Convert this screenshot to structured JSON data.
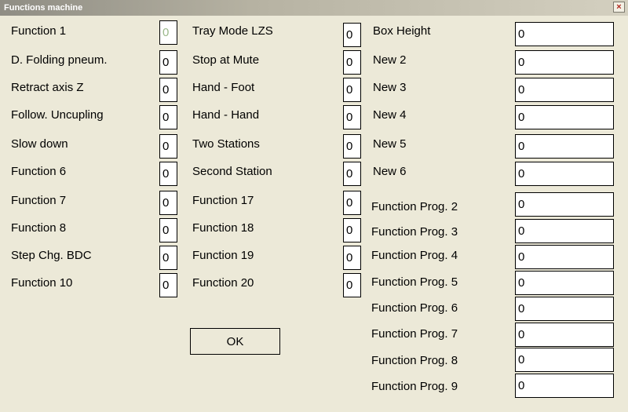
{
  "window": {
    "title": "Functions machine",
    "close_glyph": "×"
  },
  "col1": [
    {
      "label": "Function 1",
      "value": "0"
    },
    {
      "label": "D. Folding pneum.",
      "value": "0"
    },
    {
      "label": "Retract axis Z",
      "value": "0"
    },
    {
      "label": "Follow. Uncupling",
      "value": "0"
    },
    {
      "label": "Slow down",
      "value": "0"
    },
    {
      "label": "Function 6",
      "value": "0"
    },
    {
      "label": "Function 7",
      "value": "0"
    },
    {
      "label": "Function 8",
      "value": "0"
    },
    {
      "label": "Step Chg. BDC",
      "value": "0"
    },
    {
      "label": "Function 10",
      "value": "0"
    }
  ],
  "col2": [
    {
      "label": "Tray Mode LZS",
      "value": "0"
    },
    {
      "label": "Stop at Mute",
      "value": "0"
    },
    {
      "label": "Hand - Foot",
      "value": "0"
    },
    {
      "label": "Hand - Hand",
      "value": "0"
    },
    {
      "label": "Two Stations",
      "value": "0"
    },
    {
      "label": "Second Station",
      "value": "0"
    },
    {
      "label": "Function 17",
      "value": "0"
    },
    {
      "label": "Function 18",
      "value": "0"
    },
    {
      "label": "Function 19",
      "value": "0"
    },
    {
      "label": "Function 20",
      "value": "0"
    }
  ],
  "col3": [
    {
      "label": "Box Height",
      "value": "0"
    },
    {
      "label": "New 2",
      "value": "0"
    },
    {
      "label": "New 3",
      "value": "0"
    },
    {
      "label": "New 4",
      "value": "0"
    },
    {
      "label": "New 5",
      "value": "0"
    },
    {
      "label": "New 6",
      "value": "0"
    },
    {
      "label": "Function Prog. 2",
      "value": "0"
    },
    {
      "label": "Function Prog. 3",
      "value": "0"
    },
    {
      "label": "Function Prog. 4",
      "value": "0"
    },
    {
      "label": "Function Prog. 5",
      "value": "0"
    },
    {
      "label": "Function Prog. 6",
      "value": "0"
    },
    {
      "label": "Function Prog. 7",
      "value": "0"
    },
    {
      "label": "Function Prog. 8",
      "value": "0"
    },
    {
      "label": "Function Prog. 9",
      "value": "0"
    }
  ],
  "ok_label": "OK"
}
